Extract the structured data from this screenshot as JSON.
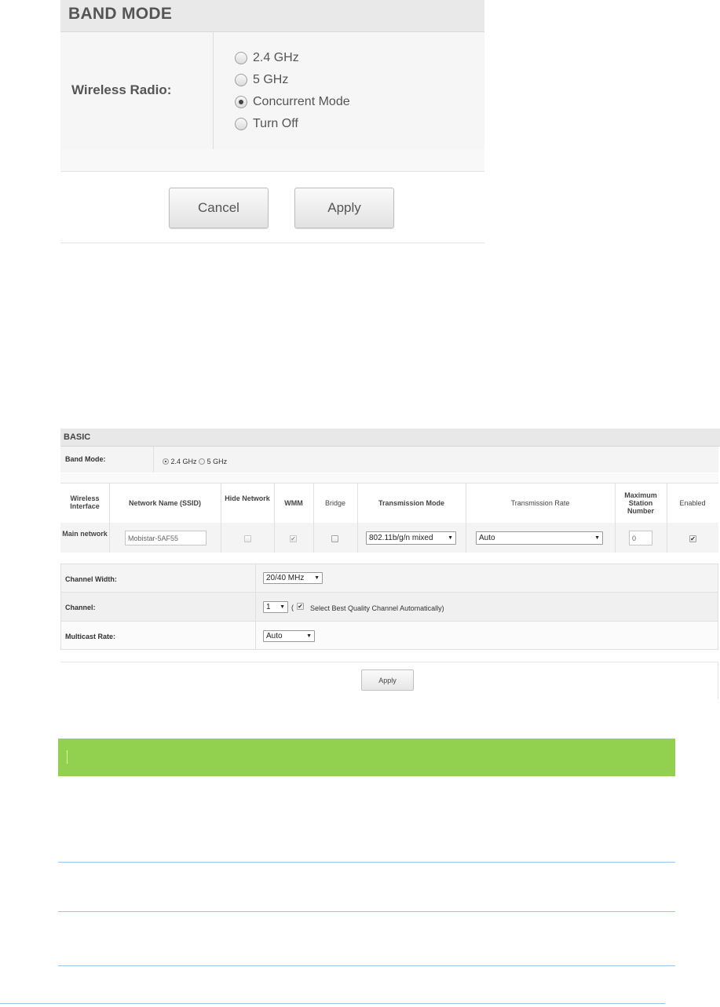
{
  "band_mode": {
    "title": "BAND MODE",
    "wireless_radio_label": "Wireless Radio:",
    "options": [
      "2.4 GHz",
      "5 GHz",
      "Concurrent Mode",
      "Turn Off"
    ],
    "selected": "Concurrent Mode",
    "cancel_label": "Cancel",
    "apply_label": "Apply"
  },
  "basic": {
    "title": "BASIC",
    "band_mode_label": "Band Mode:",
    "band_options": [
      "2.4 GHz",
      "5 GHz"
    ],
    "band_selected": "2.4 GHz",
    "table": {
      "headers": {
        "interface": "Wireless Interface",
        "ssid": "Network Name (SSID)",
        "hide": "Hide Network",
        "wmm": "WMM",
        "bridge": "Bridge",
        "mode": "Transmission Mode",
        "rate": "Transmission Rate",
        "max_station": "Maximum Station Number",
        "enabled": "Enabled"
      },
      "row": {
        "interface": "Main network",
        "ssid": "Mobistar-5AF55",
        "hide_network": false,
        "wmm": true,
        "wmm_disabled": true,
        "bridge": false,
        "mode": "802.11b/g/n mixed",
        "rate": "Auto",
        "max_station": "0",
        "enabled": true
      }
    },
    "channel_width_label": "Channel Width:",
    "channel_width_value": "20/40 MHz",
    "channel_label": "Channel:",
    "channel_value": "1",
    "auto_channel_open": "(",
    "auto_channel_checked": true,
    "auto_channel_label": "Select Best Quality Channel Automatically)",
    "multicast_label": "Multicast Rate:",
    "multicast_value": "Auto",
    "apply_label": "Apply"
  },
  "colors": {
    "green_header": "#92d050",
    "rule_blue": "#9dc3e6",
    "panel_header_gray": "#e9e9e9"
  }
}
